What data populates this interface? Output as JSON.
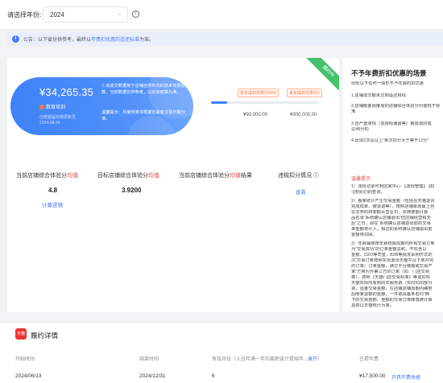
{
  "filter": {
    "year_label": "请选择年份:",
    "year_value": "2024",
    "info_icon": "info-circle-icon"
  },
  "notice": {
    "icon": "info-icon",
    "text_prefix": "公告：以下省份供参考，最终以",
    "text_link": "年费扣优惠的适还标准",
    "text_suffix": "为准。"
  },
  "banner": {
    "amount": "¥34,265.35",
    "badge": "数育培训",
    "sub_line1": "创建首届扣缴更新至",
    "sub_line2": "2024-08-24",
    "desc": "ⓘ该成交数据用于店铺自然年内的技术年费结算，当前数据仅供参考，以实际结算为准。",
    "tip": "温馨提示：月度账单将根据您最底交易日期为准。"
  },
  "progress": {
    "fraction": 0.15,
    "tick_a": "金年提扣优惠为50%",
    "tick_b": "金年提扣优惠为1",
    "val_a": "¥90,000.00",
    "val_b": "¥300,000.00"
  },
  "status_ribbon": "履约中",
  "metrics": {
    "h1_prefix": "当前店铺综合体验分",
    "h1_hl": "均值",
    "h2_prefix": "目标店铺综合体验分",
    "h2_hl": "均值",
    "h3_prefix": "当前店铺综合体验分",
    "h3_hl": "均值",
    "h3_suffix": "结果",
    "h4": "违规扣分情况 ⓘ",
    "v1": "4.8",
    "v2": "3.9200",
    "link1": "计算逻辑",
    "link4": "查看"
  },
  "side": {
    "title": "不予年费折扣优惠的场景",
    "lines": [
      "出现以下任何一情形不予年费的扣优惠",
      "1.店铺成交额未达到适还目标",
      "2.店铺额量周度周的店铺综合体验分均值低于标",
      "准",
      "3.自严重违规（如违规遭留等）被退退的或",
      "达48分的",
      "4.出现2次及以上“单次扣分大于等于12分”"
    ],
    "warn": "温馨提示:",
    "lines2": [
      "1）违规记录可到店家中心-【违规管理】-[扣",
      "-[违规记录]查询。",
      "2）看家统计产生交易金额（包括在天猫退货",
      "完成成单、被退退等），按照店铺单周最上自",
      "在非劳的统罪额从营业日、非牌要额计算",
      "品名录“系统确认店铺退出”但店铺经营和天",
      "后”之日，即在“系统确认店铺退出前的交易",
      "单金额将计入；相应的系统确认店铺退出前",
      "金额将扣除。",
      "3）年费最账按年费统算周期内所有交易订单",
      "为“交易成功”的订单金额总和，不包含以",
      "金额、O2O等司室，B2B等批发采购形式的",
      "2C交易订单按照实现退出天猫平台下单并完",
      "的订单）订单金额，通过平台缴施或交易产",
      "家”方用为外第三方的订单（如：门店交易",
      "菜），按照《天猫门店交易标准》等退扣规",
      "天猫实际所收到的年服务费（实时扣扣部分",
      "费，运量交易金额，在店铺店铺周期内确根",
      "后哪家退额的金额，一件或具备条名均“两",
      "下的交易金额，虽额的交易订单降落被计算",
      "具体以天猫统计为准。"
    ]
  },
  "detail": {
    "shop_icon": "天猫",
    "title": "履约详情",
    "col1": "开始时间",
    "col2": "结束时间",
    "col3_prefix": "有效月份（入驻年满一年的离职该计提结年...",
    "col3_link": "展开",
    "col3_suffix": "）",
    "col4": "已提年费",
    "row": {
      "start": "2024/06/13",
      "end": "2024/12/31",
      "months": "6",
      "fee": "¥17,500.00",
      "fee_link": "开具年费收据"
    }
  }
}
